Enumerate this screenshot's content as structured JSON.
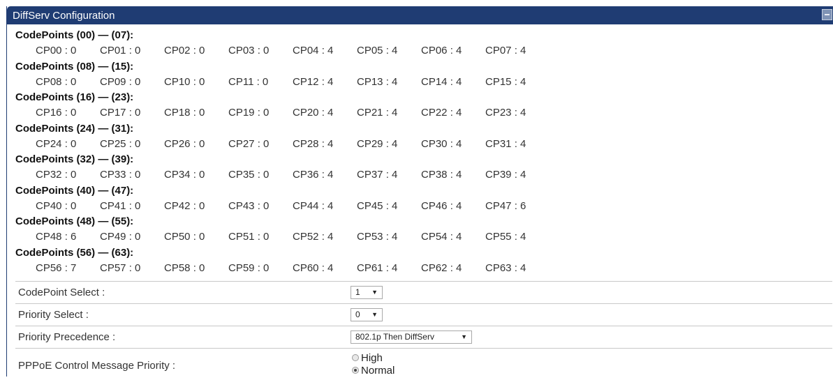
{
  "panel": {
    "title": "DiffServ Configuration"
  },
  "codepoints": {
    "groups": [
      {
        "title": "CodePoints (00) — (07):",
        "items": [
          "CP00 : 0",
          "CP01 : 0",
          "CP02 : 0",
          "CP03 : 0",
          "CP04 : 4",
          "CP05 : 4",
          "CP06 : 4",
          "CP07 : 4"
        ]
      },
      {
        "title": "CodePoints (08) — (15):",
        "items": [
          "CP08 : 0",
          "CP09 : 0",
          "CP10 : 0",
          "CP11 : 0",
          "CP12 : 4",
          "CP13 : 4",
          "CP14 : 4",
          "CP15 : 4"
        ]
      },
      {
        "title": "CodePoints (16) — (23):",
        "items": [
          "CP16 : 0",
          "CP17 : 0",
          "CP18 : 0",
          "CP19 : 0",
          "CP20 : 4",
          "CP21 : 4",
          "CP22 : 4",
          "CP23 : 4"
        ]
      },
      {
        "title": "CodePoints (24) — (31):",
        "items": [
          "CP24 : 0",
          "CP25 : 0",
          "CP26 : 0",
          "CP27 : 0",
          "CP28 : 4",
          "CP29 : 4",
          "CP30 : 4",
          "CP31 : 4"
        ]
      },
      {
        "title": "CodePoints (32) — (39):",
        "items": [
          "CP32 : 0",
          "CP33 : 0",
          "CP34 : 0",
          "CP35 : 0",
          "CP36 : 4",
          "CP37 : 4",
          "CP38 : 4",
          "CP39 : 4"
        ]
      },
      {
        "title": "CodePoints (40) — (47):",
        "items": [
          "CP40 : 0",
          "CP41 : 0",
          "CP42 : 0",
          "CP43 : 0",
          "CP44 : 4",
          "CP45 : 4",
          "CP46 : 4",
          "CP47 : 6"
        ]
      },
      {
        "title": "CodePoints (48) — (55):",
        "items": [
          "CP48 : 6",
          "CP49 : 0",
          "CP50 : 0",
          "CP51 : 0",
          "CP52 : 4",
          "CP53 : 4",
          "CP54 : 4",
          "CP55 : 4"
        ]
      },
      {
        "title": "CodePoints (56) — (63):",
        "items": [
          "CP56 : 7",
          "CP57 : 0",
          "CP58 : 0",
          "CP59 : 0",
          "CP60 : 4",
          "CP61 : 4",
          "CP62 : 4",
          "CP63 : 4"
        ]
      }
    ]
  },
  "settings": {
    "codepoint_select": {
      "label": "CodePoint Select :",
      "value": "1"
    },
    "priority_select": {
      "label": "Priority Select :",
      "value": "0"
    },
    "priority_precedence": {
      "label": "Priority Precedence :",
      "value": "802.1p Then DiffServ"
    },
    "pppoe_priority": {
      "label": "PPPoE Control Message Priority :",
      "options": [
        "High",
        "Normal"
      ],
      "selected": "Normal"
    }
  },
  "icons": {
    "collapse": "collapse-icon",
    "dropdown": "chevron-down-icon",
    "radio": "radio-icon"
  },
  "colors": {
    "titlebar": "#1f3c73",
    "title_text": "#ffffff"
  }
}
